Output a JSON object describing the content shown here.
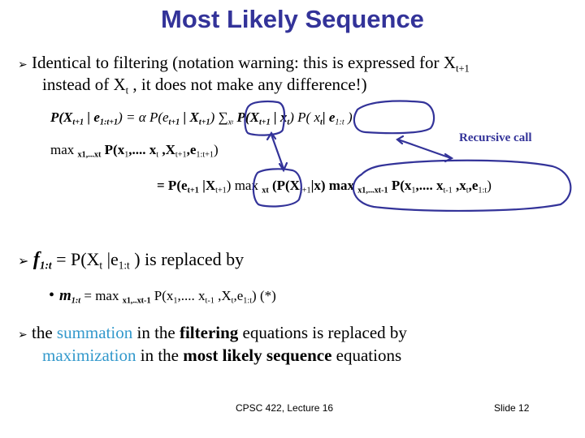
{
  "slide": {
    "title": "Most Likely Sequence",
    "accent_color": "#333399",
    "highlight_color": "#3399cc"
  },
  "bullet1": {
    "icon": "arrow-bullet-icon",
    "line1_pre": "Identical to filtering (notation warning: this is expressed for X",
    "line1_sub": "t+1",
    "line2_pre": "instead of X",
    "line2_sub": "t",
    "line2_post": " , it does not make any difference!)"
  },
  "equations": {
    "filter": {
      "p1": "P(X",
      "s1": "t+1",
      "p2": " | e",
      "s2": "1:t+1",
      "p3": ") = α P(e",
      "s3": "t+1",
      "p4": " | X",
      "s4": "t+1",
      "p5": ") ∑",
      "s5": "x",
      "s5b": "t",
      "p6": " P(X",
      "s6": "t+1",
      "p7": " | x",
      "s7": "t",
      "p8": ") P( x",
      "s8": "t",
      "p9": "| e",
      "s9": "1:t",
      "p10": " )"
    },
    "max_line": {
      "p1": "max ",
      "s1": "x1,...xt",
      "p2": " P(x",
      "s2": "1",
      "p3": ",.... x",
      "s3": "t",
      "p4": " ,X",
      "s4": "t+1",
      "p5": ",e",
      "s5": "1:t+1",
      "p6": ")"
    },
    "recursion": {
      "p1": "=  P(e",
      "s1": "t+1",
      "p2": " |X",
      "s2": "t+1",
      "p3": ") max ",
      "s3": "xt",
      "p4": " (P(X",
      "s4": "t+1",
      "p5": "|x) max ",
      "s5": "x1,...xt-1",
      "p6": " P(x",
      "s6": "1",
      "p7": ",.... x",
      "s7": "t-1",
      "p8": " ,x",
      "s8": "t",
      "p9": ",e",
      "s9": "1:t",
      "p10": ")"
    },
    "recursive_call_label": "Recursive call"
  },
  "bullet2": {
    "icon": "arrow-bullet-icon",
    "f": "f",
    "f_sub": "1:t",
    "p1": " =  P(X",
    "s1": "t",
    "p2": " |e",
    "s2": "1:t",
    "p3": " ) is replaced by",
    "sub_bullet": {
      "icon": "dot-bullet-icon",
      "m": "m",
      "m_sub": "1:t",
      "p1": "  = max ",
      "s1": "x1,..xt-1",
      "p2": " P(x",
      "s2": "1",
      "p3": ",.... x",
      "s3": "t-1",
      "p4": " ,X",
      "s4": "t",
      "p5": ",e",
      "s5": "1:t",
      "p6": ")   (*)"
    }
  },
  "bullet3": {
    "icon": "arrow-bullet-icon",
    "w1": "the ",
    "w2": "summation",
    "w3": " in the ",
    "w4": "filtering",
    "w5": " equations is replaced by",
    "w6": "maximization",
    "w7": " in the ",
    "w8": "most likely sequence",
    "w9": " equations"
  },
  "footer": {
    "course": "CPSC 422, Lecture 16",
    "slide_number": "Slide 12"
  }
}
